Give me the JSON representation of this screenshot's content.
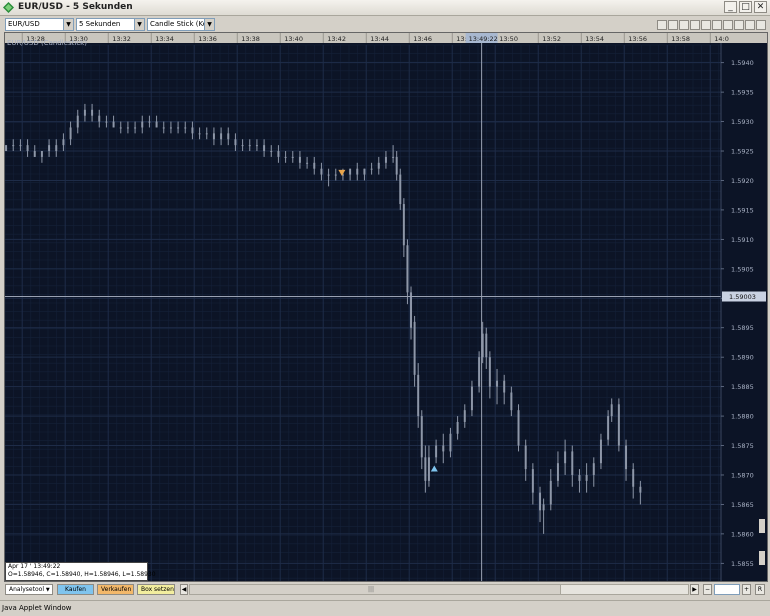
{
  "window": {
    "title": "EUR/USD - 5 Sekunden",
    "controls": [
      "_",
      "□",
      "✕"
    ]
  },
  "toolbar": {
    "instrument": "EUR/USD",
    "period": "5 Sekunden",
    "chart_type": "Candle Stick (Kerze"
  },
  "chart_data": {
    "type": "candlestick",
    "title": "EUR/USD (Candlestick)",
    "x_ticks": [
      "13:28",
      "13:30",
      "13:32",
      "13:34",
      "13:36",
      "13:38",
      "13:40",
      "13:42",
      "13:44",
      "13:46",
      "13:48",
      "13:50",
      "13:52",
      "13:54",
      "13:56",
      "13:58",
      "14:0"
    ],
    "y_ticks": [
      "1.5940",
      "1.5935",
      "1.5930",
      "1.5925",
      "1.5920",
      "1.5915",
      "1.5910",
      "1.5905",
      "1.5900",
      "1.5895",
      "1.5890",
      "1.5885",
      "1.5880",
      "1.5875",
      "1.5870",
      "1.5865",
      "1.5860",
      "1.5855"
    ],
    "ylim": [
      1.5852,
      1.5943
    ],
    "xlim": [
      "13:27:12",
      "14:00:30"
    ],
    "crosshair": {
      "time_label": "13:49:22",
      "price_label": "1.59003",
      "time": "13:49:22",
      "price": 1.59003
    },
    "series": [
      {
        "name": "EUR/USD",
        "values": [
          [
            "13:27:15",
            1.5926,
            1.5926,
            1.5925,
            1.5925
          ],
          [
            "13:27:35",
            1.5926,
            1.5927,
            1.5925,
            1.5926
          ],
          [
            "13:27:55",
            1.5926,
            1.5927,
            1.5925,
            1.5926
          ],
          [
            "13:28:15",
            1.5926,
            1.5927,
            1.5924,
            1.5925
          ],
          [
            "13:28:35",
            1.5925,
            1.5926,
            1.5924,
            1.5924
          ],
          [
            "13:28:55",
            1.5924,
            1.5925,
            1.5923,
            1.5925
          ],
          [
            "13:29:15",
            1.5925,
            1.5927,
            1.5924,
            1.5926
          ],
          [
            "13:29:35",
            1.5926,
            1.5927,
            1.5924,
            1.5925
          ],
          [
            "13:29:55",
            1.5926,
            1.5928,
            1.5925,
            1.5927
          ],
          [
            "13:30:15",
            1.5927,
            1.593,
            1.5926,
            1.5929
          ],
          [
            "13:30:35",
            1.5929,
            1.5932,
            1.5928,
            1.5931
          ],
          [
            "13:30:55",
            1.5931,
            1.5933,
            1.593,
            1.5932
          ],
          [
            "13:31:15",
            1.5932,
            1.5933,
            1.593,
            1.5931
          ],
          [
            "13:31:35",
            1.5931,
            1.5932,
            1.5929,
            1.593
          ],
          [
            "13:31:55",
            1.593,
            1.5931,
            1.5929,
            1.593
          ],
          [
            "13:32:15",
            1.593,
            1.5931,
            1.5929,
            1.5929
          ],
          [
            "13:32:35",
            1.5929,
            1.593,
            1.5928,
            1.5929
          ],
          [
            "13:32:55",
            1.5929,
            1.593,
            1.5928,
            1.5929
          ],
          [
            "13:33:15",
            1.5929,
            1.593,
            1.5928,
            1.5929
          ],
          [
            "13:33:35",
            1.5929,
            1.5931,
            1.5928,
            1.593
          ],
          [
            "13:33:55",
            1.593,
            1.5931,
            1.5929,
            1.593
          ],
          [
            "13:34:15",
            1.593,
            1.5931,
            1.5929,
            1.5929
          ],
          [
            "13:34:35",
            1.5929,
            1.593,
            1.5928,
            1.5929
          ],
          [
            "13:34:55",
            1.5929,
            1.593,
            1.5928,
            1.5929
          ],
          [
            "13:35:15",
            1.5929,
            1.593,
            1.5928,
            1.5929
          ],
          [
            "13:35:35",
            1.5929,
            1.593,
            1.5928,
            1.5929
          ],
          [
            "13:35:55",
            1.5929,
            1.593,
            1.5927,
            1.5928
          ],
          [
            "13:36:15",
            1.5928,
            1.5929,
            1.5927,
            1.5928
          ],
          [
            "13:36:35",
            1.5928,
            1.5929,
            1.5927,
            1.5928
          ],
          [
            "13:36:55",
            1.5928,
            1.5929,
            1.5926,
            1.5927
          ],
          [
            "13:37:15",
            1.5927,
            1.5929,
            1.5926,
            1.5928
          ],
          [
            "13:37:35",
            1.5928,
            1.5929,
            1.5926,
            1.5927
          ],
          [
            "13:37:55",
            1.5927,
            1.5928,
            1.5925,
            1.5926
          ],
          [
            "13:38:15",
            1.5926,
            1.5927,
            1.5925,
            1.5926
          ],
          [
            "13:38:35",
            1.5926,
            1.5927,
            1.5925,
            1.5926
          ],
          [
            "13:38:55",
            1.5926,
            1.5927,
            1.5925,
            1.5926
          ],
          [
            "13:39:15",
            1.5926,
            1.5927,
            1.5924,
            1.5925
          ],
          [
            "13:39:35",
            1.5925,
            1.5926,
            1.5924,
            1.5925
          ],
          [
            "13:39:55",
            1.5925,
            1.5926,
            1.5923,
            1.5924
          ],
          [
            "13:40:15",
            1.5924,
            1.5925,
            1.5923,
            1.5924
          ],
          [
            "13:40:35",
            1.5924,
            1.5925,
            1.5923,
            1.5924
          ],
          [
            "13:40:55",
            1.5924,
            1.5925,
            1.5922,
            1.5923
          ],
          [
            "13:41:15",
            1.5923,
            1.5924,
            1.5922,
            1.5923
          ],
          [
            "13:41:35",
            1.5923,
            1.5924,
            1.5921,
            1.5922
          ],
          [
            "13:41:55",
            1.5922,
            1.5923,
            1.592,
            1.5921
          ],
          [
            "13:42:15",
            1.5921,
            1.5922,
            1.5919,
            1.5921
          ],
          [
            "13:42:35",
            1.5921,
            1.5922,
            1.592,
            1.5921
          ],
          [
            "13:42:55",
            1.5921,
            1.5922,
            1.592,
            1.5921
          ],
          [
            "13:43:15",
            1.5921,
            1.5922,
            1.592,
            1.5922
          ],
          [
            "13:43:35",
            1.5922,
            1.5923,
            1.592,
            1.5921
          ],
          [
            "13:43:55",
            1.5921,
            1.5922,
            1.592,
            1.5922
          ],
          [
            "13:44:15",
            1.5922,
            1.5923,
            1.5921,
            1.5922
          ],
          [
            "13:44:35",
            1.5922,
            1.5924,
            1.5921,
            1.5923
          ],
          [
            "13:44:55",
            1.5923,
            1.5925,
            1.5922,
            1.5924
          ],
          [
            "13:45:15",
            1.5924,
            1.5926,
            1.5923,
            1.5924
          ],
          [
            "13:45:25",
            1.5924,
            1.5925,
            1.592,
            1.5921
          ],
          [
            "13:45:35",
            1.5921,
            1.5922,
            1.5915,
            1.5916
          ],
          [
            "13:45:45",
            1.5916,
            1.5917,
            1.5907,
            1.5909
          ],
          [
            "13:45:55",
            1.5909,
            1.591,
            1.5899,
            1.5901
          ],
          [
            "13:46:05",
            1.5901,
            1.5902,
            1.5893,
            1.5895
          ],
          [
            "13:46:15",
            1.5896,
            1.5897,
            1.5885,
            1.5887
          ],
          [
            "13:46:25",
            1.5887,
            1.5889,
            1.5878,
            1.588
          ],
          [
            "13:46:35",
            1.588,
            1.5881,
            1.5871,
            1.5873
          ],
          [
            "13:46:45",
            1.5873,
            1.5875,
            1.5867,
            1.5869
          ],
          [
            "13:46:55",
            1.5869,
            1.5875,
            1.5868,
            1.5873
          ],
          [
            "13:47:15",
            1.5873,
            1.5876,
            1.5872,
            1.5875
          ],
          [
            "13:47:35",
            1.5875,
            1.5877,
            1.5872,
            1.5874
          ],
          [
            "13:47:55",
            1.5874,
            1.5878,
            1.5873,
            1.5877
          ],
          [
            "13:48:15",
            1.5877,
            1.588,
            1.5876,
            1.5879
          ],
          [
            "13:48:35",
            1.5879,
            1.5882,
            1.5878,
            1.5881
          ],
          [
            "13:48:55",
            1.5881,
            1.5886,
            1.588,
            1.5885
          ],
          [
            "13:49:15",
            1.5885,
            1.5891,
            1.5884,
            1.589
          ],
          [
            "13:49:25",
            1.589,
            1.5896,
            1.5889,
            1.5894
          ],
          [
            "13:49:35",
            1.5894,
            1.5895,
            1.5888,
            1.589
          ],
          [
            "13:49:45",
            1.589,
            1.5891,
            1.5883,
            1.5885
          ],
          [
            "13:50:05",
            1.5885,
            1.5888,
            1.5882,
            1.5886
          ],
          [
            "13:50:25",
            1.5886,
            1.5887,
            1.5882,
            1.5884
          ],
          [
            "13:50:45",
            1.5884,
            1.5885,
            1.588,
            1.5881
          ],
          [
            "13:51:05",
            1.5881,
            1.5882,
            1.5874,
            1.5875
          ],
          [
            "13:51:25",
            1.5875,
            1.5876,
            1.5869,
            1.5871
          ],
          [
            "13:51:45",
            1.5871,
            1.5872,
            1.5865,
            1.5867
          ],
          [
            "13:52:05",
            1.5867,
            1.5868,
            1.5862,
            1.5864
          ],
          [
            "13:52:15",
            1.5864,
            1.5866,
            1.586,
            1.5865
          ],
          [
            "13:52:35",
            1.5865,
            1.5871,
            1.5864,
            1.5869
          ],
          [
            "13:52:55",
            1.5869,
            1.5874,
            1.5868,
            1.5872
          ],
          [
            "13:53:15",
            1.5872,
            1.5876,
            1.587,
            1.5874
          ],
          [
            "13:53:35",
            1.5874,
            1.5875,
            1.5868,
            1.587
          ],
          [
            "13:53:55",
            1.587,
            1.5871,
            1.5867,
            1.5869
          ],
          [
            "13:54:15",
            1.5869,
            1.5872,
            1.5867,
            1.587
          ],
          [
            "13:54:35",
            1.587,
            1.5873,
            1.5868,
            1.5872
          ],
          [
            "13:54:55",
            1.5872,
            1.5877,
            1.5871,
            1.5876
          ],
          [
            "13:55:15",
            1.5876,
            1.5881,
            1.5875,
            1.588
          ],
          [
            "13:55:25",
            1.588,
            1.5883,
            1.5879,
            1.5882
          ],
          [
            "13:55:45",
            1.5882,
            1.5883,
            1.5874,
            1.5875
          ],
          [
            "13:56:05",
            1.5875,
            1.5876,
            1.5869,
            1.5871
          ],
          [
            "13:56:25",
            1.5871,
            1.5872,
            1.5866,
            1.5868
          ],
          [
            "13:56:45",
            1.5868,
            1.5869,
            1.5865,
            1.5867
          ]
        ]
      }
    ],
    "markers": [
      {
        "type": "sell",
        "time": "13:42:52",
        "price": 1.59213
      },
      {
        "type": "buy",
        "time": "13:47:10",
        "price": 1.58711
      }
    ],
    "info_box": {
      "line1": "Apr 17 ' 13:49:22",
      "line2": "O=1.58946, C=1.58940, H=1.58946, L=1.58930"
    },
    "grid": true
  },
  "bottom_toolbar": {
    "analysis": "Analysetool",
    "buy": "Kaufen",
    "sell": "Verkaufen",
    "box": "Box setzen",
    "scroll_glyph": "|||",
    "minus": "−",
    "plus": "+",
    "r": "R"
  },
  "status": {
    "text": "Java Applet Window"
  },
  "colors": {
    "chart_bg": "#0c1426",
    "grid": "#1e2c48",
    "candle": "#8e97a8",
    "axis_text": "#a8b1c4",
    "buy_button": "#7fc4ee",
    "sell_button": "#f3b86a",
    "box_button": "#f2ed9e",
    "sell_marker": "#e9a54c",
    "buy_marker": "#7fc4ee"
  }
}
